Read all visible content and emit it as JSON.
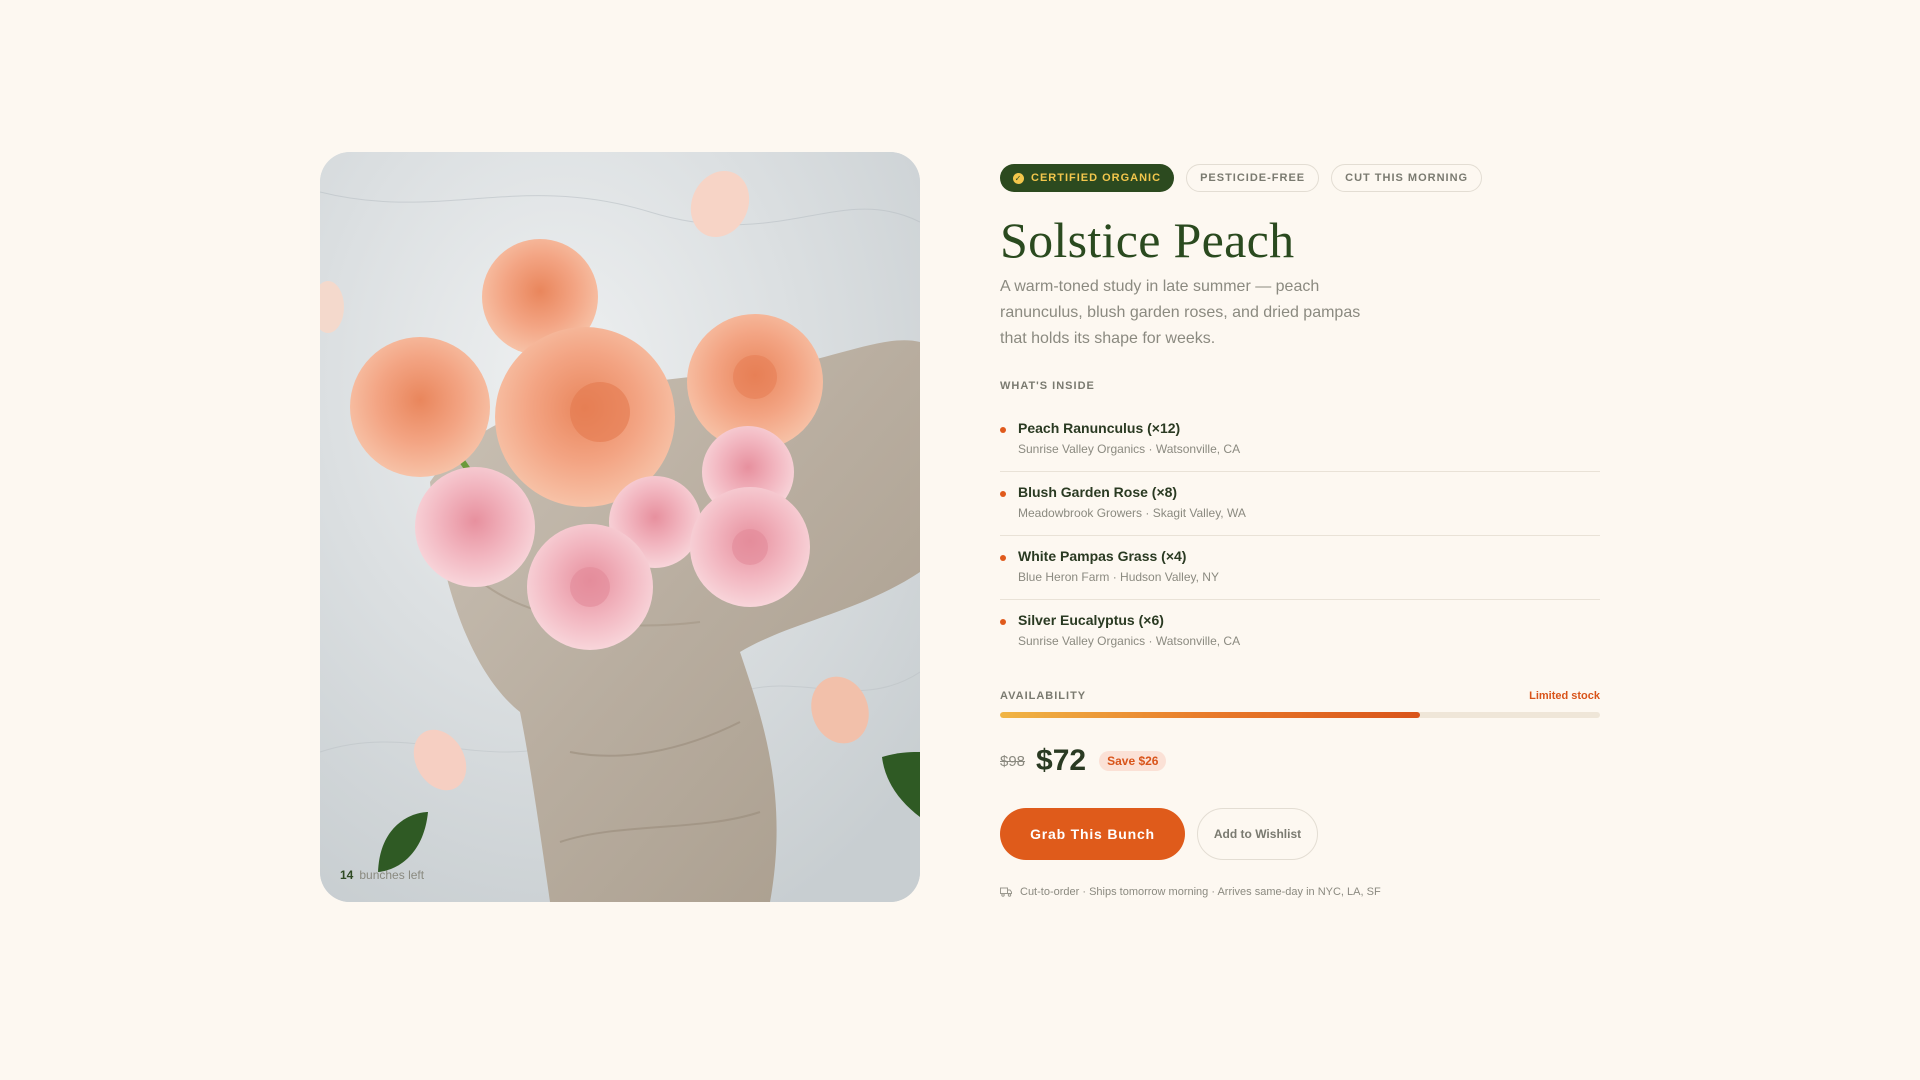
{
  "image": {
    "stock_count": "14",
    "stock_text": "bunches left"
  },
  "badges": [
    {
      "label": "CERTIFIED ORGANIC",
      "icon": "check-icon"
    },
    {
      "label": "PESTICIDE-FREE"
    },
    {
      "label": "CUT THIS MORNING"
    }
  ],
  "product": {
    "title": "Solstice Peach",
    "description": "A warm-toned study in late summer — peach ranunculus, blush garden roses, and dried pampas that holds its shape for weeks."
  },
  "contents": {
    "label": "WHAT'S INSIDE",
    "items": [
      {
        "name": "Peach Ranunculus (×12)",
        "origin": "Sunrise Valley Organics · Watsonville, CA"
      },
      {
        "name": "Blush Garden Rose (×8)",
        "origin": "Meadowbrook Growers · Skagit Valley, WA"
      },
      {
        "name": "White Pampas Grass (×4)",
        "origin": "Blue Heron Farm · Hudson Valley, NY"
      },
      {
        "name": "Silver Eucalyptus (×6)",
        "origin": "Sunrise Valley Organics · Watsonville, CA"
      }
    ]
  },
  "availability": {
    "label": "AVAILABILITY",
    "status": "Limited stock",
    "fill_fraction": 0.7
  },
  "pricing": {
    "old_price": "$98",
    "price": "$72",
    "save": "Save $26"
  },
  "actions": {
    "primary": "Grab This Bunch",
    "secondary": "Add to Wishlist"
  },
  "shipping": {
    "icon": "truck-icon",
    "text": "Cut-to-order · Ships tomorrow morning · Arrives same-day in NYC, LA, SF"
  },
  "colors": {
    "background": "#fdf8f1",
    "forest": "#2c4a1f",
    "gold": "#f3c64c",
    "accent": "#df5b1b"
  }
}
